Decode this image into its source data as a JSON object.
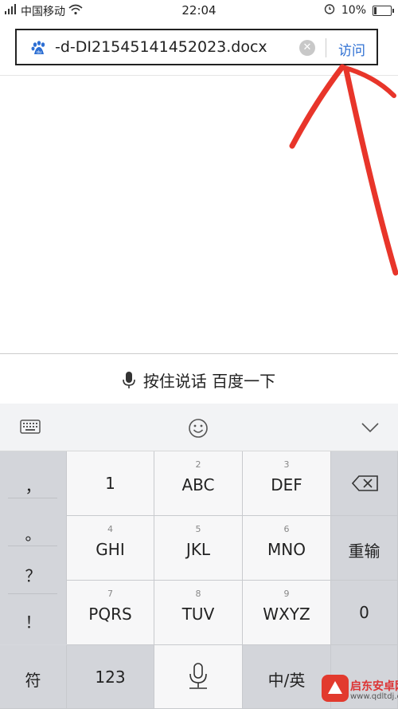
{
  "status_bar": {
    "carrier": "中国移动",
    "time": "22:04",
    "battery": "10%"
  },
  "address_bar": {
    "url": "-d-DI21545141452023.docx",
    "visit_label": "访问"
  },
  "voice_bar": {
    "label": "按住说话 百度一下"
  },
  "keyboard": {
    "side_keys": [
      "，",
      "。",
      "？",
      "！"
    ],
    "keys": [
      {
        "num": "",
        "label": "1"
      },
      {
        "num": "2",
        "label": "ABC"
      },
      {
        "num": "3",
        "label": "DEF"
      },
      {
        "num": "4",
        "label": "GHI"
      },
      {
        "num": "5",
        "label": "JKL"
      },
      {
        "num": "6",
        "label": "MNO"
      },
      {
        "num": "7",
        "label": "PQRS"
      },
      {
        "num": "8",
        "label": "TUV"
      },
      {
        "num": "9",
        "label": "WXYZ"
      }
    ],
    "reenter_label": "重输",
    "zero_label": "0",
    "symbol_label": "符",
    "numeric_label": "123",
    "lang_label": "中/英"
  },
  "watermark": {
    "text": "启东安卓网",
    "sub": "www.qdltdj.com"
  },
  "colors": {
    "accent": "#2d6fd3",
    "arrow": "#e8352a"
  }
}
